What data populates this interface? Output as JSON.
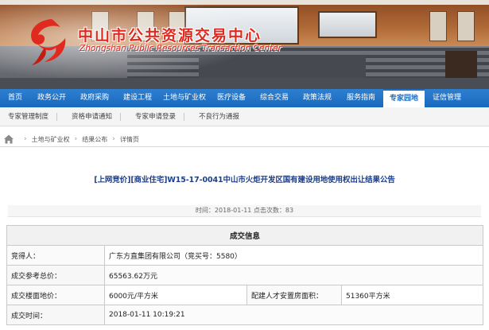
{
  "header": {
    "site_title": "中山市公共资源交易中心",
    "site_subtitle": "Zhongshan Public Resources Transaction Center"
  },
  "main_nav": [
    {
      "label": "首页"
    },
    {
      "label": "政务公开"
    },
    {
      "label": "政府采购"
    },
    {
      "label": "建设工程"
    },
    {
      "label": "土地与矿业权"
    },
    {
      "label": "医疗设备"
    },
    {
      "label": "综合交易"
    },
    {
      "label": "政策法规"
    },
    {
      "label": "服务指南"
    },
    {
      "label": "专家园地",
      "active": true
    },
    {
      "label": "证信管理"
    }
  ],
  "sub_nav": [
    {
      "label": "专家管理制度"
    },
    {
      "label": "资格申请通知"
    },
    {
      "label": "专家申请登录"
    },
    {
      "label": "不良行为通报"
    }
  ],
  "breadcrumb": [
    "土地与矿业权",
    "结果公布",
    "详情页"
  ],
  "article": {
    "title": "[上网竞价][商业住宅]W15-17-0041中山市火炬开发区国有建设用地使用权出让结果公告",
    "meta": "时间：2018-01-11 点击次数：83"
  },
  "table": {
    "header": "成交信息",
    "rows": [
      {
        "label": "竞得人：",
        "value": "广东方直集团有限公司（竞买号：5580）"
      },
      {
        "label": "成交参考总价：",
        "value": "65563.62万元"
      },
      {
        "label": "成交楼面地价：",
        "value": "6000元/平方米",
        "label2": "配建人才安置房面积：",
        "value2": "51360平方米"
      },
      {
        "label": "成交时间：",
        "value": "2018-01-11 10:19:21"
      }
    ]
  },
  "colors": {
    "nav_blue": "#1769bd",
    "title_blue": "#1d3f8a",
    "brand_red": "#e02a20"
  }
}
